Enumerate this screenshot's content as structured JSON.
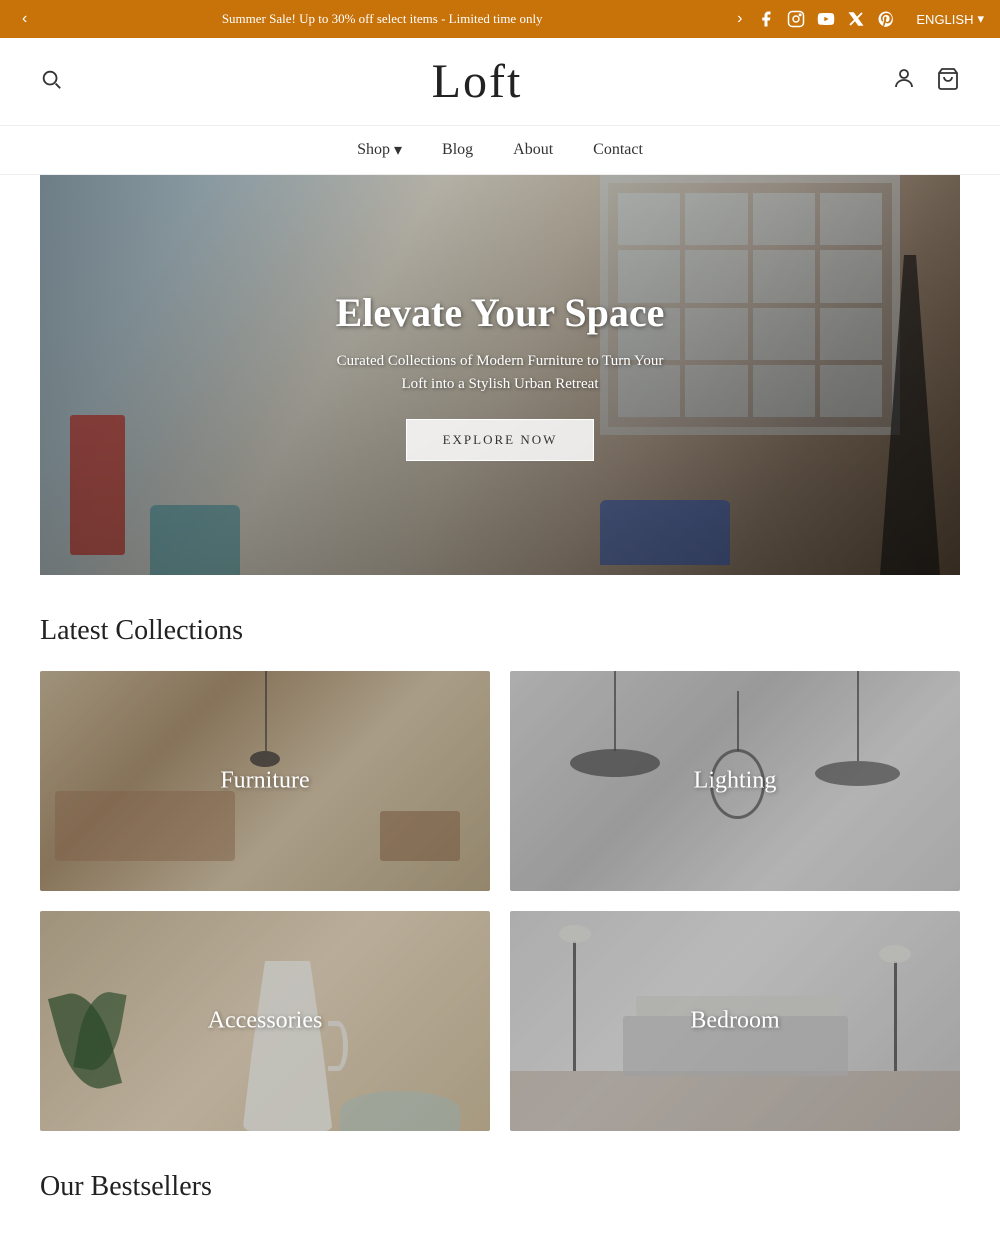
{
  "announcement": {
    "text": "Summer Sale! Up to 30% off select items - Limited time only",
    "prev_label": "‹",
    "next_label": "›",
    "lang": "ENGLISH"
  },
  "social": {
    "facebook": "f",
    "instagram": "◉",
    "youtube": "▶",
    "twitter": "𝕏",
    "pinterest": "𝙋"
  },
  "header": {
    "logo": "Loft",
    "search_label": "🔍",
    "account_label": "👤",
    "cart_label": "🛒"
  },
  "nav": {
    "items": [
      {
        "label": "Shop",
        "has_dropdown": true
      },
      {
        "label": "Blog",
        "has_dropdown": false
      },
      {
        "label": "About",
        "has_dropdown": false
      },
      {
        "label": "Contact",
        "has_dropdown": false
      }
    ]
  },
  "hero": {
    "title": "Elevate Your Space",
    "subtitle": "Curated Collections of Modern Furniture to Turn Your Loft into a Stylish Urban Retreat",
    "cta_label": "EXPLORE NOW"
  },
  "collections": {
    "section_title": "Latest Collections",
    "items": [
      {
        "label": "Furniture",
        "bg_class": "bg-furniture"
      },
      {
        "label": "Lighting",
        "bg_class": "bg-lighting"
      },
      {
        "label": "Accessories",
        "bg_class": "bg-accessories"
      },
      {
        "label": "Bedroom",
        "bg_class": "bg-bedroom"
      }
    ]
  },
  "bestsellers": {
    "section_title": "Our Bestsellers"
  }
}
